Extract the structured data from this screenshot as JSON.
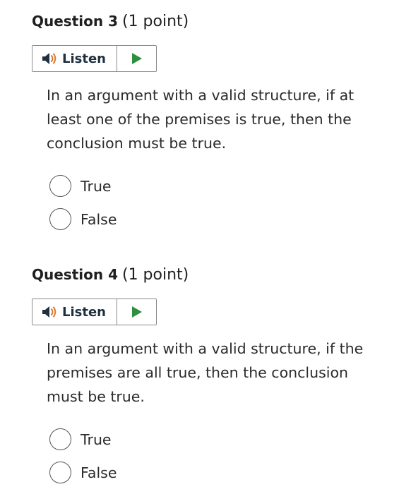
{
  "questions": [
    {
      "title": "Question 3",
      "points": "(1 point)",
      "listen_label": "Listen",
      "text": "In an argument with a valid structure, if at least one of the premises is true, then the conclusion must be true.",
      "options": [
        "True",
        "False"
      ]
    },
    {
      "title": "Question 4",
      "points": "(1 point)",
      "listen_label": "Listen",
      "text": "In an argument with a valid structure, if the premises are all true, then the conclusion must be true.",
      "options": [
        "True",
        "False"
      ]
    }
  ],
  "icons": {
    "speaker": "speaker-icon",
    "play": "play-icon"
  },
  "colors": {
    "speaker_body": "#1f2f3f",
    "speaker_waves": "#e0762a",
    "play": "#2f8f3f",
    "border": "#8a8a8a",
    "text": "#2b2b2b"
  }
}
